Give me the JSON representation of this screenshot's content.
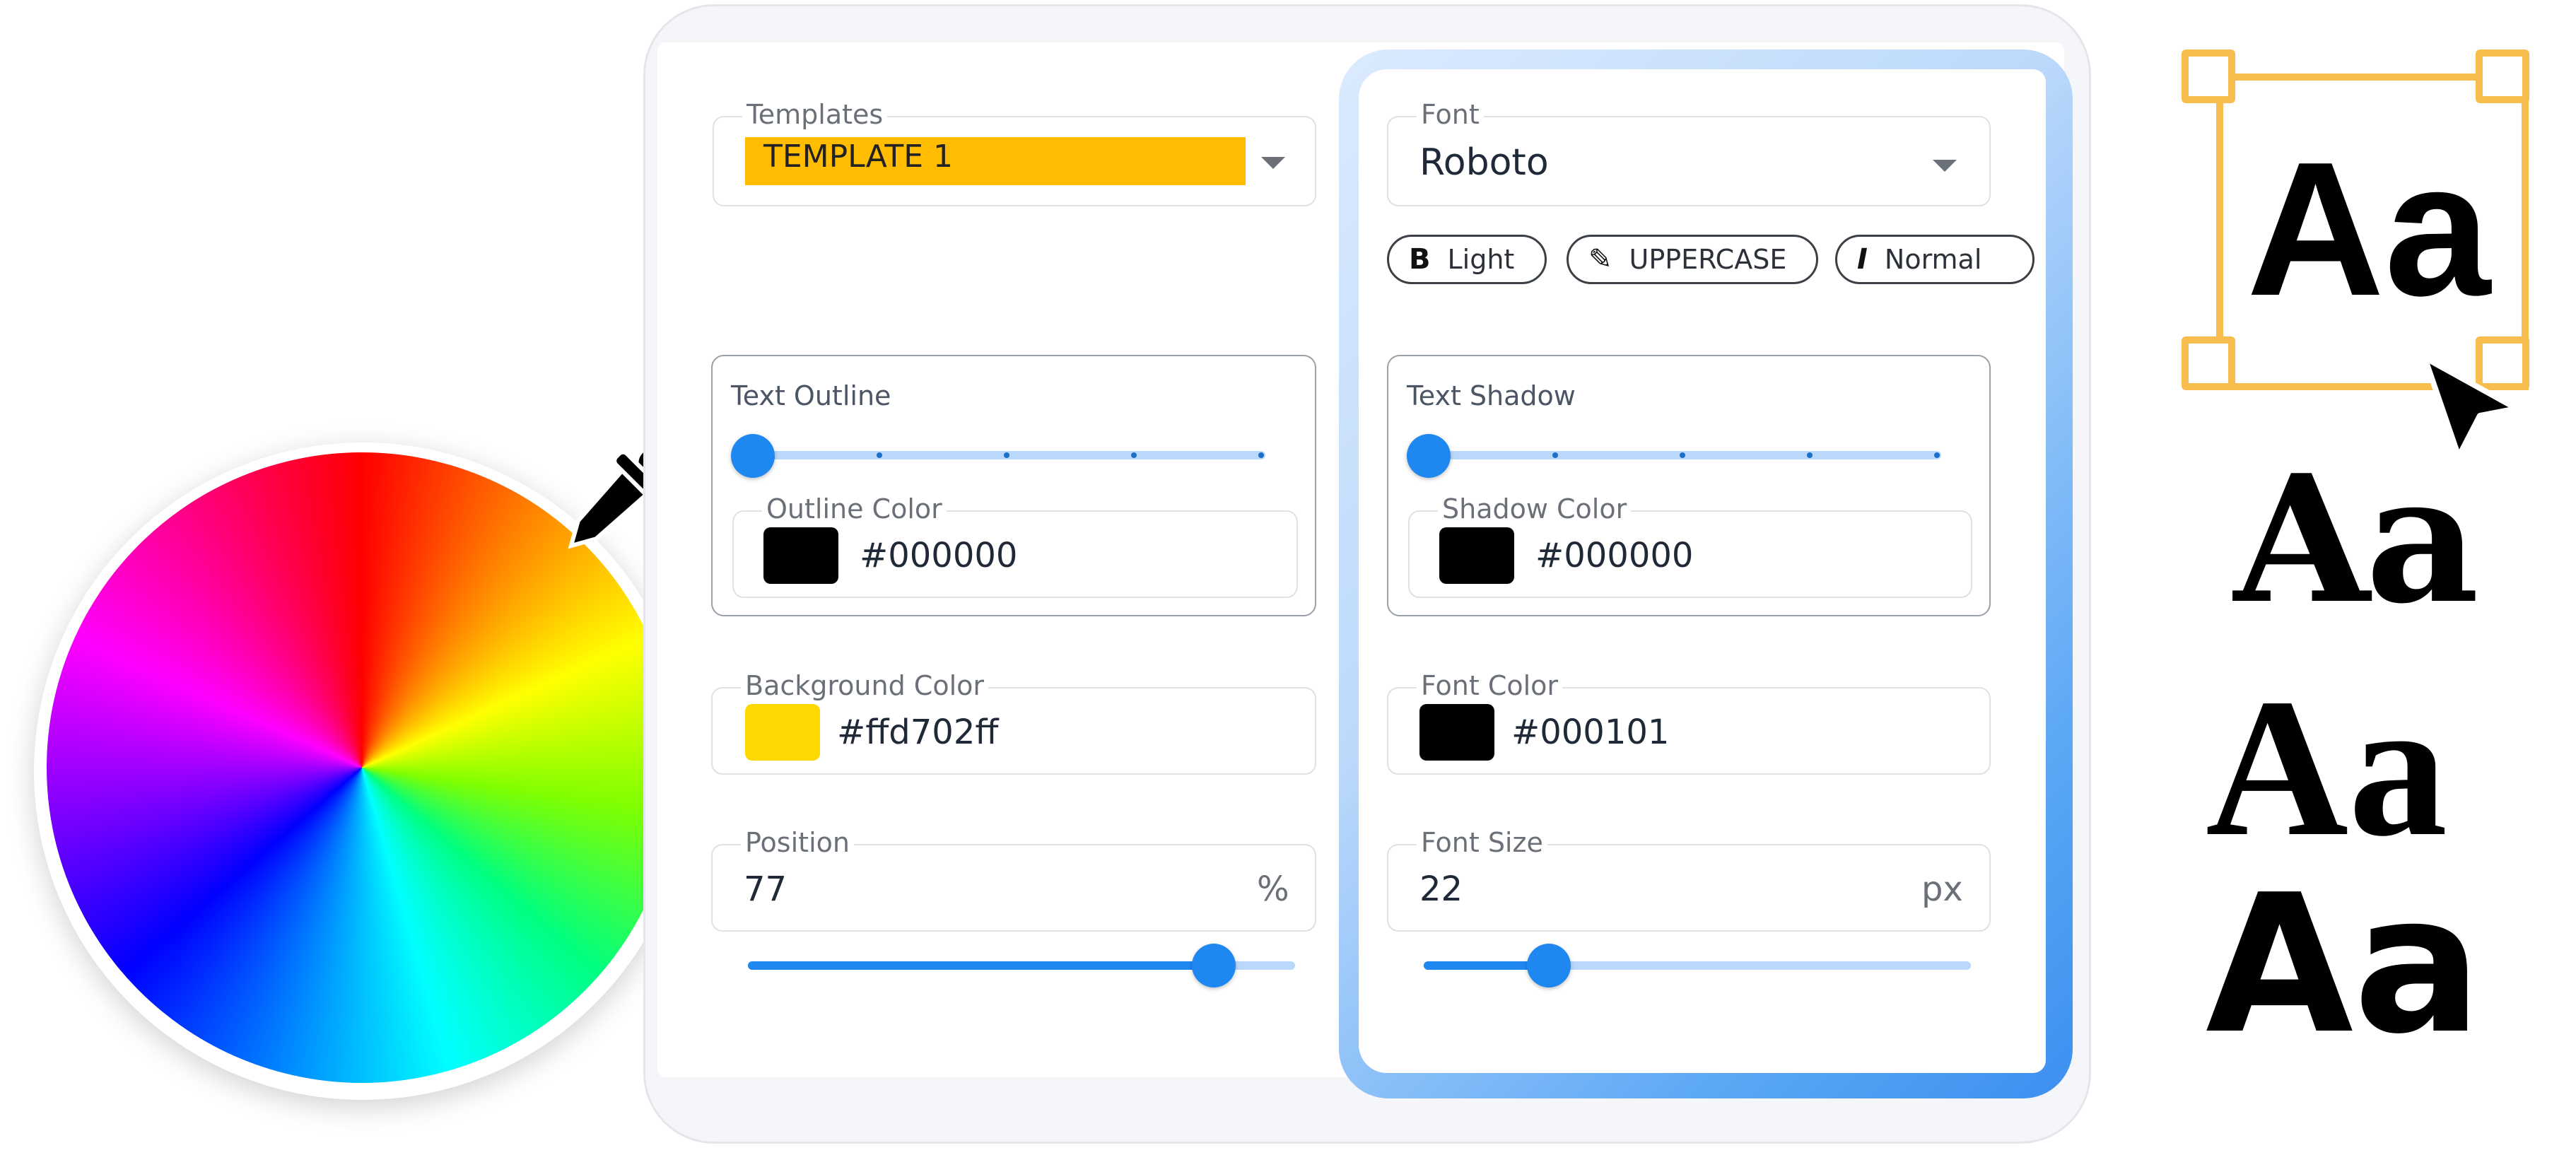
{
  "templates": {
    "label": "Templates",
    "value": "TEMPLATE 1",
    "highlight_color": "#ffbc00"
  },
  "font": {
    "label": "Font",
    "value": "Roboto"
  },
  "chips": [
    {
      "icon": "bold-icon",
      "glyph": "B",
      "label": "Light"
    },
    {
      "icon": "brush-icon",
      "glyph": "✎",
      "label": "UPPERCASE"
    },
    {
      "icon": "italic-icon",
      "glyph": "I",
      "label": "Normal"
    }
  ],
  "text_outline": {
    "title": "Text Outline",
    "color_label": "Outline Color",
    "color_value": "#000000",
    "swatch": "#000000",
    "level": 0
  },
  "text_shadow": {
    "title": "Text Shadow",
    "color_label": "Shadow Color",
    "color_value": "#000000",
    "swatch": "#000000",
    "level": 0
  },
  "background_color": {
    "label": "Background Color",
    "value": "#ffd702ff",
    "swatch": "#ffd702"
  },
  "font_color": {
    "label": "Font Color",
    "value": "#000101",
    "swatch": "#000101"
  },
  "position": {
    "label": "Position",
    "value": "77",
    "unit": "%",
    "level_fraction": 0.85
  },
  "font_size": {
    "label": "Font Size",
    "value": "22",
    "unit": "px",
    "level_fraction": 0.23
  },
  "samples": {
    "selected": "Aa",
    "slab": "Aa",
    "serif": "Aa",
    "heavy": "Aa"
  },
  "colors": {
    "accent": "#1e88f0",
    "selection": "#f7bd4f"
  }
}
